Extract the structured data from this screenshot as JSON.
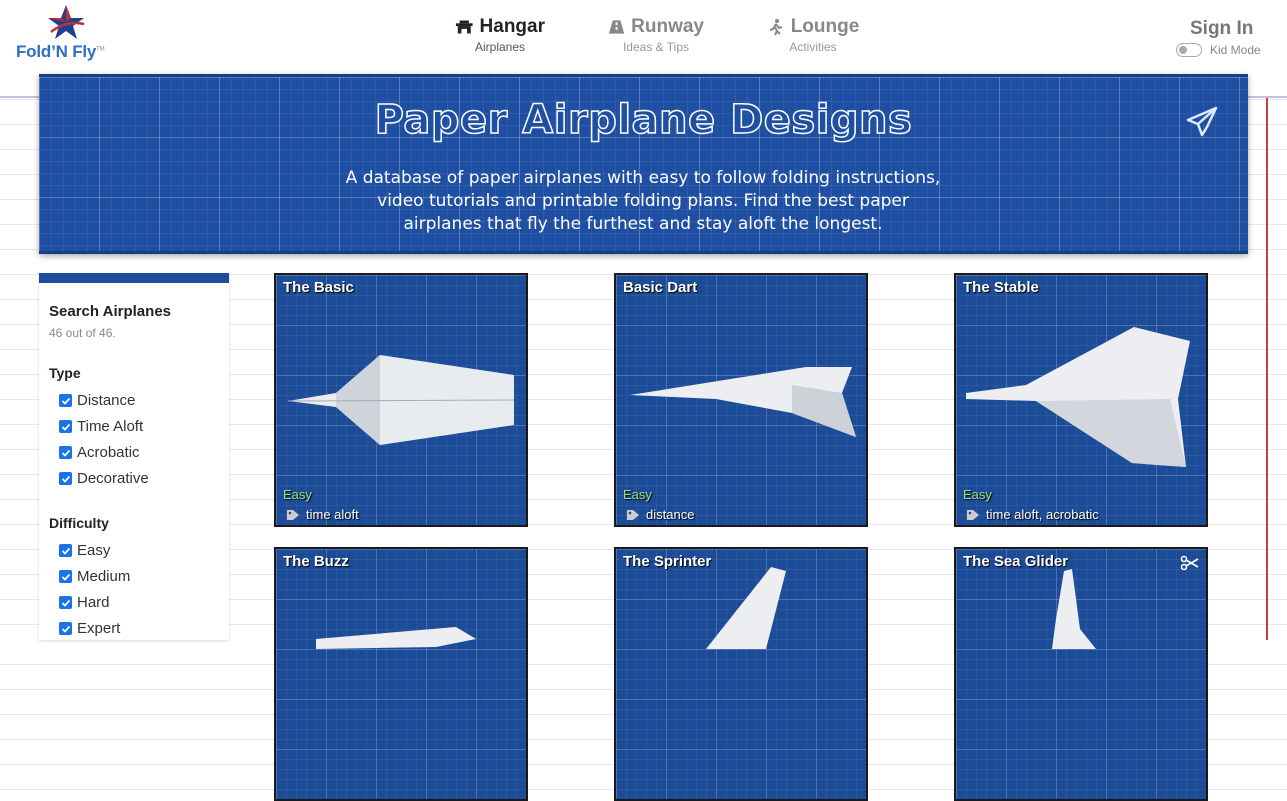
{
  "header": {
    "logo_text": "Fold’N Fly",
    "nav": [
      {
        "label": "Hangar",
        "sub": "Airplanes",
        "icon": "hangar-icon",
        "active": true
      },
      {
        "label": "Runway",
        "sub": "Ideas & Tips",
        "icon": "runway-icon",
        "active": false
      },
      {
        "label": "Lounge",
        "sub": "Activities",
        "icon": "lounge-icon",
        "active": false
      }
    ],
    "sign_in": "Sign In",
    "kid_mode_label": "Kid Mode",
    "kid_mode_on": false
  },
  "banner": {
    "title": "Paper Airplane Designs",
    "description": "A database of paper airplanes with easy to follow folding instructions, video tutorials and printable folding plans. Find the best paper airplanes that fly the furthest and stay aloft the longest."
  },
  "sidebar": {
    "title": "Search Airplanes",
    "count": "46 out of 46.",
    "type_heading": "Type",
    "types": [
      "Distance",
      "Time Aloft",
      "Acrobatic",
      "Decorative"
    ],
    "difficulty_heading": "Difficulty",
    "difficulties": [
      "Easy",
      "Medium",
      "Hard",
      "Expert"
    ]
  },
  "cards": [
    {
      "title": "The Basic",
      "difficulty": "Easy",
      "tags": "time aloft"
    },
    {
      "title": "Basic Dart",
      "difficulty": "Easy",
      "tags": "distance"
    },
    {
      "title": "The Stable",
      "difficulty": "Easy",
      "tags": "time aloft, acrobatic"
    },
    {
      "title": "The Buzz"
    },
    {
      "title": "The Sprinter"
    },
    {
      "title": "The Sea Glider"
    }
  ],
  "colors": {
    "brand_blue": "#2a71c4",
    "blueprint_blue": "#1f4fa3",
    "easy_green": "#9fe07a",
    "checkbox_blue": "#1a73e8"
  }
}
